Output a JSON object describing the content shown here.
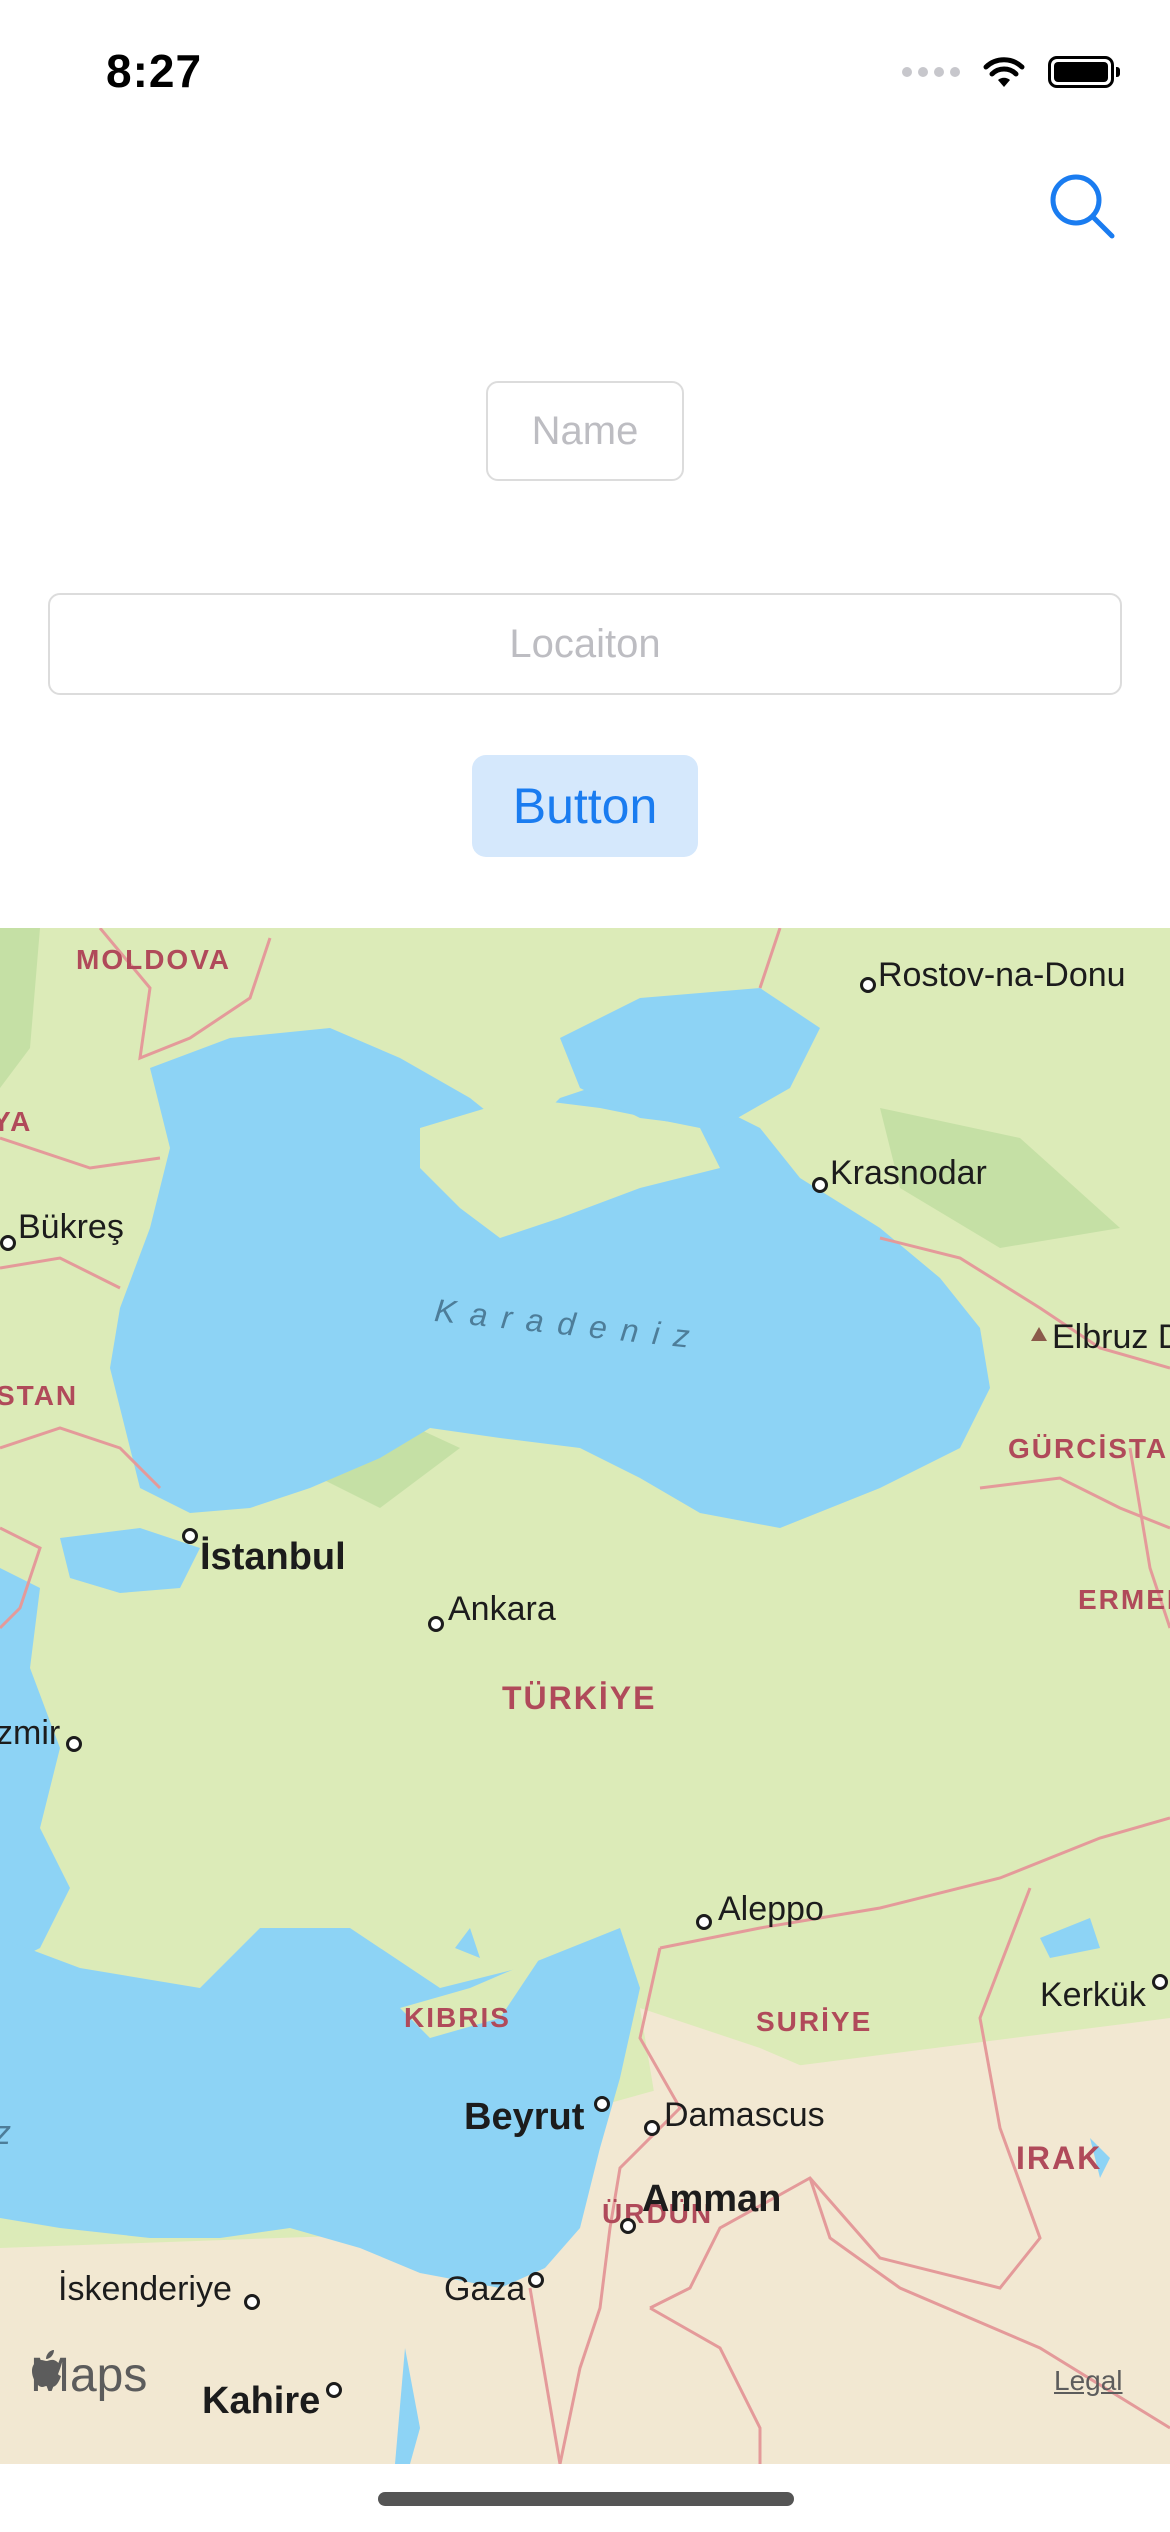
{
  "status_bar": {
    "time": "8:27"
  },
  "form": {
    "name_placeholder": "Name",
    "location_placeholder": "Locaiton",
    "button_label": "Button"
  },
  "colors": {
    "accent": "#1a7cf0",
    "button_bg": "#d5e8fc",
    "water": "#8dd3f5",
    "land": "#dcebb8",
    "border": "#e49a9a"
  },
  "map": {
    "sea": "Karadeniz",
    "cities": {
      "rostov": "Rostov-na-Donu",
      "krasnodar": "Krasnodar",
      "bukres": "Bükreş",
      "elbruz": "Elbruz D",
      "istanbul": "İstanbul",
      "ankara": "Ankara",
      "izmir": "zmir",
      "aleppo": "Aleppo",
      "kerkuk": "Kerkük",
      "beyrut": "Beyrut",
      "damascus": "Damascus",
      "amman": "Amman",
      "iskenderiye": "İskenderiye",
      "gaza": "Gaza",
      "kahire": "Kahire"
    },
    "countries": {
      "moldova": "MOLDOVA",
      "ya": "YA",
      "stan": "STAN",
      "gurcistan": "GÜRCİSTAN",
      "ermen": "ERMEN",
      "turkiye": "TÜRKİYE",
      "kibris": "KIBRIS",
      "suriye": "SURİYE",
      "irak": "IRAK",
      "urdun": "ÜRDÜN"
    },
    "edge_z": "z",
    "attribution": "Maps",
    "legal": "Legal"
  }
}
